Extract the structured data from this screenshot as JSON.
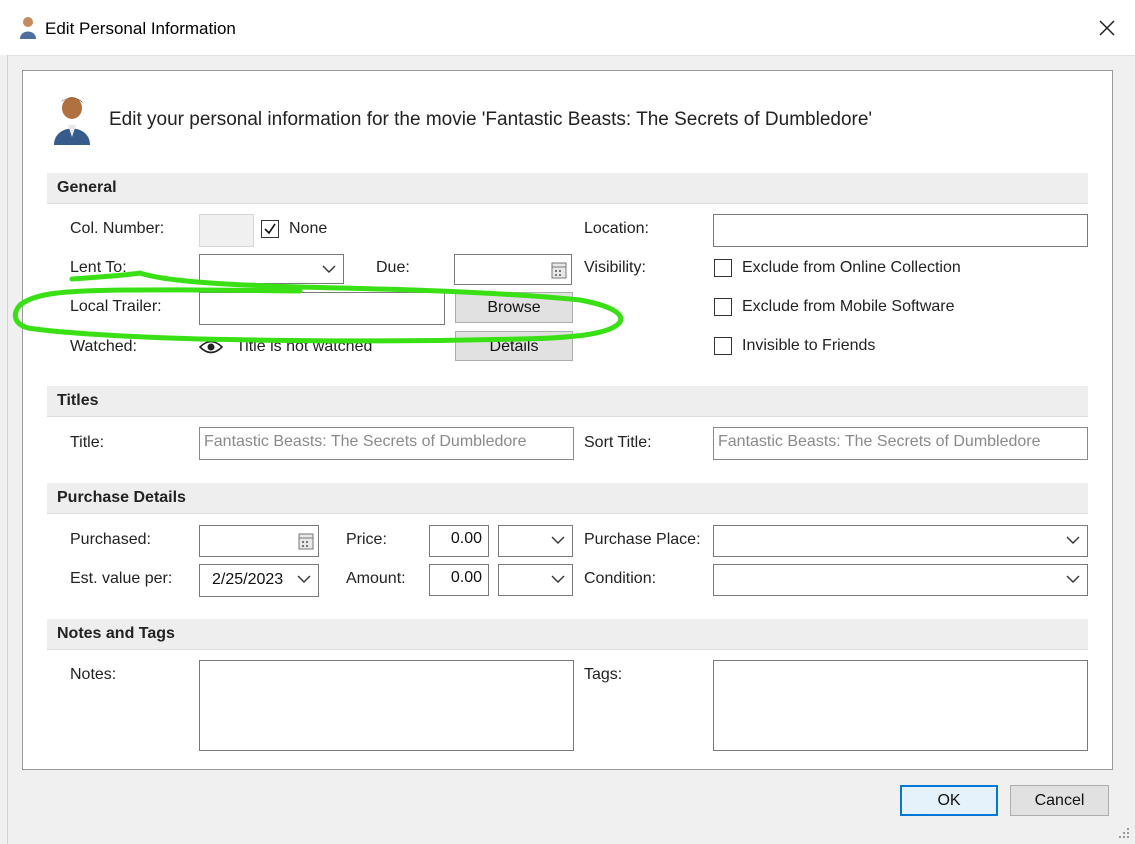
{
  "window": {
    "title": "Edit Personal Information"
  },
  "header": {
    "text": "Edit your personal information for the movie 'Fantastic Beasts: The Secrets of Dumbledore'"
  },
  "sections": {
    "general": "General",
    "titles": "Titles",
    "purchase": "Purchase Details",
    "notes": "Notes and Tags"
  },
  "general": {
    "col_number_label": "Col. Number:",
    "none_label": "None",
    "none_checked": true,
    "location_label": "Location:",
    "location_value": "",
    "lent_to_label": "Lent To:",
    "lent_to_value": "",
    "due_label": "Due:",
    "visibility_label": "Visibility:",
    "exclude_online_label": "Exclude from Online Collection",
    "exclude_mobile_label": "Exclude from Mobile Software",
    "invisible_friends_label": "Invisible to Friends",
    "local_trailer_label": "Local Trailer:",
    "local_trailer_value": "",
    "browse_label": "Browse",
    "watched_label": "Watched:",
    "watched_status": "Title is not watched",
    "details_label": "Details"
  },
  "titles": {
    "title_label": "Title:",
    "title_value": "Fantastic Beasts: The Secrets of Dumbledore",
    "sort_title_label": "Sort Title:",
    "sort_title_value": "Fantastic Beasts: The Secrets of Dumbledore"
  },
  "purchase": {
    "purchased_label": "Purchased:",
    "purchased_value": "",
    "price_label": "Price:",
    "price_value": "0.00",
    "purchase_place_label": "Purchase Place:",
    "est_value_label": "Est. value per:",
    "est_value_date": "2/25/2023",
    "amount_label": "Amount:",
    "amount_value": "0.00",
    "condition_label": "Condition:"
  },
  "notes": {
    "notes_label": "Notes:",
    "tags_label": "Tags:"
  },
  "buttons": {
    "ok": "OK",
    "cancel": "Cancel"
  },
  "colors": {
    "annotation": "#39e014",
    "accent": "#0078d7"
  }
}
